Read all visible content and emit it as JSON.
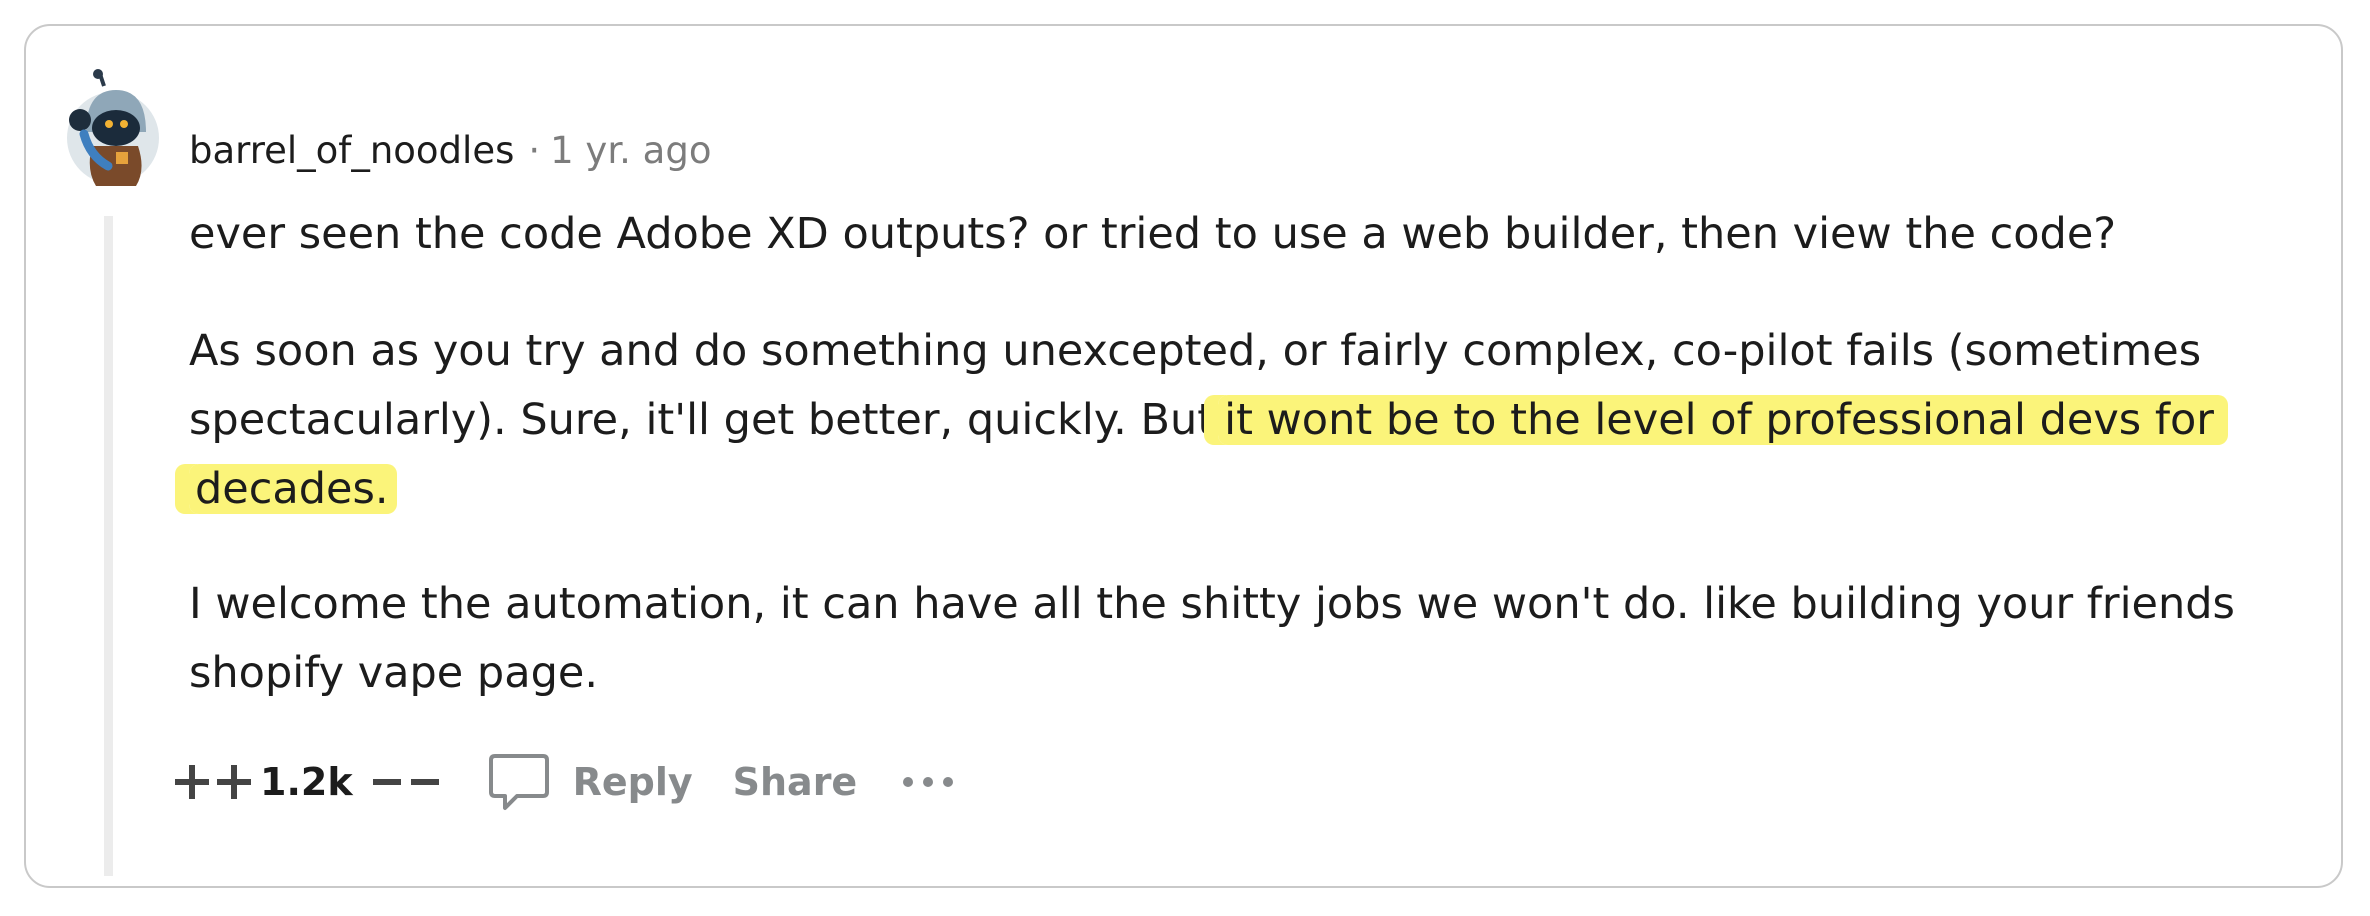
{
  "comment": {
    "author": "barrel_of_noodles",
    "separator": "·",
    "timestamp": "1 yr. ago",
    "paragraphs": {
      "p1": "ever seen the code Adobe XD outputs? or tried to use a web builder, then view the code?",
      "p2_line1": "As soon as you try and do something unexcepted, or fairly complex, co-pilot fails (sometimes",
      "p2_line2_plain": "spectacularly). Sure, it'll get better, quickly. But",
      "p2_line2_highlight": "it wont be to the level of professional devs for",
      "p2_line3_highlight": "decades.",
      "p3_line1": "I welcome the automation, it can have all the shitty jobs we won't do. like building your friends",
      "p3_line2": "shopify vape page."
    },
    "score": "1.2k",
    "actions": {
      "reply": "Reply",
      "share": "Share"
    }
  },
  "icons": {
    "upvote": "plus-icon",
    "downvote": "minus-icon",
    "reply": "speech-bubble-icon",
    "more": "ellipsis-icon",
    "avatar": "snoo-avatar"
  },
  "colors": {
    "highlight": "#fbf47a",
    "muted_text": "#7c7c7c",
    "action_gray": "#878a8c",
    "thread_line": "#ececec"
  }
}
